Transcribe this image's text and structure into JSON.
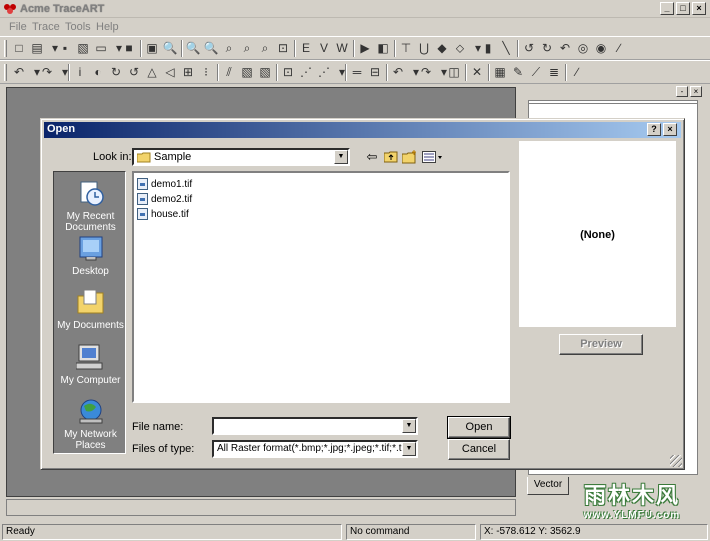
{
  "app": {
    "title": "Acme TraceART",
    "window_buttons": [
      "_",
      "□",
      "×"
    ]
  },
  "menu": [
    "File",
    "Trace",
    "Tools",
    "Help"
  ],
  "toolbar1": [
    "□",
    "▤",
    "▾",
    "▪",
    "▧",
    "▭",
    "▾",
    "■",
    "▣",
    "🔍",
    "🔍",
    "🔍",
    "⌕",
    "⌕",
    "⌕",
    "⊡",
    "E",
    "V",
    "W",
    "▶",
    "◧",
    "⊤",
    "⋃",
    "◆",
    "⬦",
    "▾",
    "▮",
    "╲",
    "↺",
    "↻",
    "↶",
    "◎",
    "◉",
    "∕"
  ],
  "toolbar2": [
    "↶",
    "▾",
    "↷",
    "▾",
    "i",
    "◐",
    "↻",
    "↺",
    "△",
    "◁",
    "⊞",
    "⁝",
    "⫽",
    "▧",
    "▧",
    "⊡",
    "⋰",
    "⋰",
    "▾",
    "═",
    "⊟",
    "↶",
    "▾",
    "↷",
    "▾",
    "◫",
    "✕",
    "▦",
    "✎",
    "⟋",
    "≣",
    "∕"
  ],
  "dialog": {
    "title": "Open",
    "title_buttons": [
      "?",
      "×"
    ],
    "look_in_label": "Look in:",
    "look_in_value": "Sample",
    "places": [
      {
        "label": "My Recent Documents",
        "icon": "recent-documents-icon"
      },
      {
        "label": "Desktop",
        "icon": "desktop-icon"
      },
      {
        "label": "My Documents",
        "icon": "my-documents-icon"
      },
      {
        "label": "My Computer",
        "icon": "my-computer-icon"
      },
      {
        "label": "My Network Places",
        "icon": "network-places-icon"
      }
    ],
    "files": [
      "demo1.tif",
      "demo2.tif",
      "house.tif"
    ],
    "file_name_label": "File name:",
    "file_name_value": "",
    "files_of_type_label": "Files of type:",
    "files_of_type_value": "All Raster format(*.bmp;*.jpg;*.jpeg;*.tif;*.tiff;*.tga",
    "open_button": "Open",
    "cancel_button": "Cancel",
    "preview_text": "(None)",
    "preview_button": "Preview"
  },
  "right_panel": {
    "tab": "Vector",
    "buttons": [
      "-",
      "×"
    ]
  },
  "status": {
    "ready": "Ready",
    "command": "No command",
    "coords": "X: -578.612 Y: 3562.9"
  },
  "watermark": {
    "main": "雨林木风",
    "url": "www.YLMFU.com"
  }
}
